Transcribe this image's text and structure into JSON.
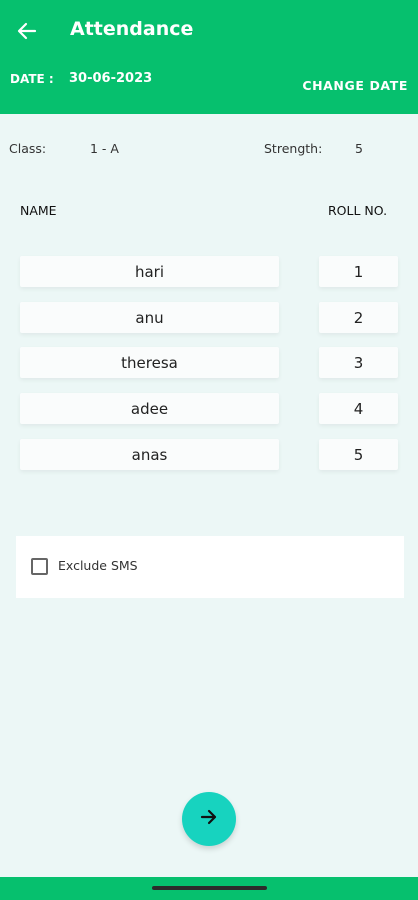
{
  "header": {
    "title": "Attendance",
    "date_label": "DATE :",
    "date_value": "30-06-2023",
    "change_date_label": "CHANGE DATE"
  },
  "info": {
    "class_label": "Class:",
    "class_value": "1 - A",
    "strength_label": "Strength:",
    "strength_value": "5"
  },
  "table": {
    "name_header": "NAME",
    "roll_header": "ROLL NO.",
    "rows": [
      {
        "name": "hari",
        "roll": "1"
      },
      {
        "name": "anu",
        "roll": "2"
      },
      {
        "name": "theresa",
        "roll": "3"
      },
      {
        "name": "adee",
        "roll": "4"
      },
      {
        "name": "anas",
        "roll": "5"
      }
    ]
  },
  "sms": {
    "label": "Exclude SMS",
    "checked": false
  },
  "icons": {
    "back": "arrow-left-icon",
    "submit": "arrow-right-icon"
  },
  "colors": {
    "header_green": "#06c06e",
    "fab_teal": "#17d3bf",
    "background": "#ecf7f6"
  }
}
